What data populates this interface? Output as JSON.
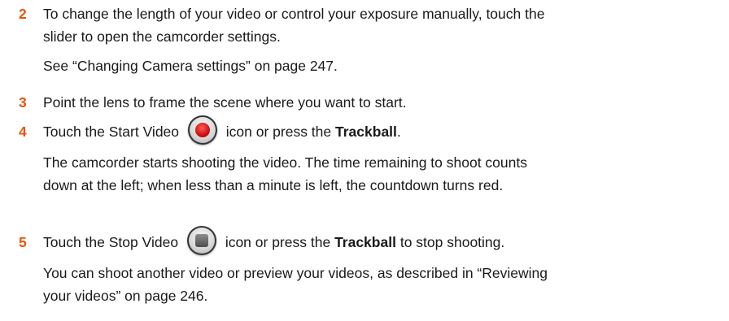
{
  "steps": [
    {
      "number": "2",
      "lines": [
        "To change the length of your video or control your exposure manually, touch the",
        "slider to open the camcorder settings."
      ],
      "sub": "See “Changing Camera settings” on page 247."
    },
    {
      "number": "3",
      "text": "Point the lens to frame the scene where you want to start."
    },
    {
      "number": "4",
      "before": "Touch the Start Video",
      "icon": "start-video-icon",
      "after": "icon or press the",
      "bold": "Trackball",
      "end": ".",
      "sub_lines": [
        "The camcorder starts shooting the video. The time remaining to shoot counts",
        "down at the left; when less than a minute is left, the countdown turns red."
      ]
    },
    {
      "number": "5",
      "before": "Touch the Stop Video",
      "icon": "stop-video-icon",
      "after": "icon or press the",
      "bold": "Trackball",
      "end": "to stop shooting.",
      "sub_lines": [
        "You can shoot another video or preview your videos, as described in “Reviewing",
        "your videos” on page 246."
      ]
    }
  ],
  "colors": {
    "step_number": "#e8550c",
    "record_red": "#d10f0f",
    "text": "#1a1a1a"
  }
}
